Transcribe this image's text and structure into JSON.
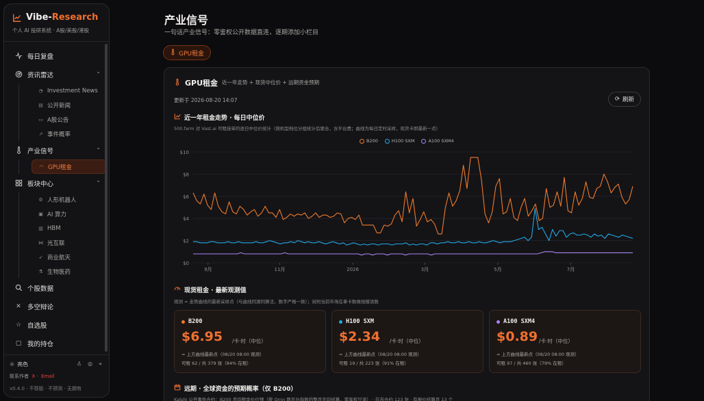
{
  "brand": {
    "name_a": "Vibe-",
    "name_b": "Research",
    "subtitle": "个人 AI 投研系统 · A股/美股/港股"
  },
  "sidebar": {
    "items": [
      {
        "label": "每日复盘",
        "icon": "pulse-icon"
      },
      {
        "label": "资讯雷达",
        "icon": "radar-icon",
        "children": [
          {
            "label": "Investment News"
          },
          {
            "label": "公开新闻"
          },
          {
            "label": "A股公告"
          },
          {
            "label": "事件概率"
          }
        ]
      },
      {
        "label": "产业信号",
        "icon": "thermometer-icon",
        "children": [
          {
            "label": "GPU租金"
          }
        ]
      },
      {
        "label": "板块中心",
        "icon": "grid-icon",
        "children": [
          {
            "label": "人形机器人"
          },
          {
            "label": "AI 算力"
          },
          {
            "label": "HBM"
          },
          {
            "label": "光互联"
          },
          {
            "label": "商业航天"
          },
          {
            "label": "生物医药"
          }
        ]
      },
      {
        "label": "个股数据",
        "icon": "search-icon"
      },
      {
        "label": "多空辩论",
        "icon": "swords-icon"
      },
      {
        "label": "自选股",
        "icon": "star-icon"
      },
      {
        "label": "我的持仓",
        "icon": "wallet-icon"
      }
    ],
    "footer": {
      "theme_label": "亮色",
      "contact_prefix": "联系作者",
      "contact_x": "X",
      "contact_email": "Email",
      "version": "v0.4.0 · 不荐股 · 不预测 · 无拥有"
    }
  },
  "page": {
    "title": "产业信号",
    "subtitle": "一句话产业信号：零鉴权公开数据直连，逐期添加小栏目",
    "tag": "GPU租金"
  },
  "card": {
    "title": "GPU租金",
    "desc": "近一年走势 + 现货中位价 + 远期资金预期",
    "updated": "更新于 2026-08-20 14:07",
    "refresh_label": "刷新",
    "trend_title": "近一年租金走势 · 每日中位价",
    "trend_note": "500.farm 对 Vast.ai 可租挂单的逐日中位价统计（按机型档位分组统计后聚合，含平台费；曲线为每日定时采样，现货卡即最新一点）",
    "spot_title": "现货租金 · 最新观测值",
    "spot_note": "观测 = 走势曲线的最新采样点（与曲线同源同算法，数字严格一致）；另附当前市场在拿卡数做规模读数",
    "forward_title": "远期 · 全球资金的预期概率（仅 B200）",
    "forward_note": "Kalshi 公开事件合约：B200 月均租金价位预（按 Ornn 两平台指数的整月平均结算，零鉴权只读） · 在市合约 123 张 · 有报价结算月 13 个"
  },
  "prices": [
    {
      "name": "B200",
      "price": "$6.95",
      "unit": "/卡·时（中位）",
      "line1": "= 上方曲线最新点（08/20 08:00 观测）",
      "line2": "可租 62 / 共 379 张（84% 在租）"
    },
    {
      "name": "H100 SXM",
      "price": "$2.34",
      "unit": "/卡·时（中位）",
      "line1": "= 上方曲线最新点（08/20 08:00 观测）",
      "line2": "可租 19 / 共 223 张（91% 在租）"
    },
    {
      "name": "A100 SXM4",
      "price": "$0.89",
      "unit": "/卡·时（中位）",
      "line1": "= 上方曲线最新点（08/20 08:00 观测）",
      "line2": "可租 97 / 共 460 张（79% 在租）"
    }
  ],
  "colors": {
    "b200": "#f07a2a",
    "h100": "#22a8e6",
    "a100": "#a885f0",
    "accent": "#f07030"
  },
  "chart_data": {
    "type": "line",
    "x_ticks": [
      "9月",
      "11月",
      "2026",
      "3月",
      "5月",
      "7月"
    ],
    "y_ticks": [
      "$0",
      "$2",
      "$4",
      "$6",
      "$8",
      "$10"
    ],
    "ylim": [
      0,
      10
    ],
    "x_index_range": [
      0,
      120
    ],
    "series": [
      {
        "name": "B200",
        "color": "#f07a2a",
        "values": [
          6.3,
          5.6,
          5.3,
          6.2,
          5.2,
          4.8,
          6.3,
          5.1,
          4.6,
          4.4,
          5.5,
          4.6,
          4.4,
          5.1,
          4.8,
          4.3,
          4.6,
          4.8,
          4.2,
          4.5,
          5.1,
          4.5,
          4.5,
          4.1,
          4.8,
          3.9,
          4.1,
          4.4,
          4.2,
          4.4,
          4.3,
          4.5,
          4.0,
          4.2,
          4.5,
          4.1,
          4.3,
          4.3,
          4.1,
          4.2,
          4.5,
          4.4,
          3.6,
          4.0,
          4.1,
          3.9,
          4.3,
          3.4,
          3.4,
          3.4,
          3.4,
          2.7,
          2.7,
          3.4,
          3.3,
          3.5,
          4.3,
          4.7,
          3.7,
          6.4,
          4.5,
          5.8,
          3.3,
          3.9,
          4.6,
          3.7,
          3.9,
          3.5,
          2.6,
          2.6,
          5.0,
          6.3,
          5.1,
          5.6,
          6.5,
          8.8,
          6.7,
          9.5,
          9.5,
          9.5,
          7.5,
          4.4,
          3.6,
          4.6,
          6.9,
          7.6,
          4.4,
          4.6,
          5.8,
          4.1,
          3.8,
          5.0,
          5.8,
          4.2,
          4.7,
          5.3,
          3.8,
          4.0,
          6.7,
          5.0,
          5.2,
          6.4,
          5.1,
          7.7,
          4.7,
          4.5,
          6.4,
          5.2,
          5.8,
          7.3,
          5.9,
          5.8,
          6.7,
          6.9,
          8.0,
          7.3,
          6.3,
          6.8,
          7.1,
          5.9,
          5.3,
          5.7,
          6.9
        ]
      },
      {
        "name": "H100 SXM",
        "color": "#22a8e6",
        "values": [
          1.9,
          1.9,
          1.8,
          1.8,
          1.8,
          1.9,
          1.9,
          1.8,
          1.8,
          1.8,
          1.9,
          1.8,
          1.8,
          1.9,
          1.8,
          1.8,
          1.8,
          1.8,
          1.9,
          1.8,
          1.8,
          1.9,
          2.0,
          1.9,
          1.8,
          1.7,
          1.8,
          1.8,
          1.9,
          1.8,
          2.0,
          1.9,
          1.8,
          1.9,
          1.8,
          1.8,
          1.9,
          1.8,
          1.7,
          1.8,
          1.9,
          1.8,
          1.7,
          1.8,
          1.6,
          1.7,
          1.8,
          1.7,
          1.6,
          1.7,
          1.6,
          1.7,
          1.7,
          1.6,
          1.7,
          1.7,
          1.7,
          1.6,
          1.7,
          1.7,
          1.7,
          1.8,
          1.6,
          1.7,
          1.6,
          1.7,
          1.7,
          1.6,
          1.8,
          1.8,
          1.7,
          1.8,
          1.8,
          1.9,
          1.8,
          1.8,
          1.9,
          1.8,
          1.8,
          1.9,
          1.8,
          1.8,
          1.9,
          1.8,
          1.8,
          1.9,
          2.0,
          1.9,
          1.8,
          1.9,
          1.9,
          1.9,
          2.0,
          2.1,
          2.2,
          2.3,
          2.0,
          2.3,
          4.9,
          3.0,
          3.2,
          2.6,
          2.0,
          3.0,
          2.4,
          2.9,
          2.9,
          2.3,
          2.6,
          2.7,
          2.5,
          2.5,
          2.6,
          2.5,
          2.3,
          2.6,
          2.4,
          2.5,
          2.2,
          2.6,
          2.5,
          2.4,
          2.3,
          2.5,
          2.4,
          2.3,
          2.2
        ]
      },
      {
        "name": "A100 SXM4",
        "color": "#a885f0",
        "values": [
          0.8,
          0.8,
          0.8,
          0.8,
          0.8,
          0.8,
          0.8,
          0.8,
          0.8,
          0.8,
          0.8,
          0.8,
          0.8,
          0.9,
          0.8,
          0.8,
          0.8,
          0.8,
          0.8,
          0.8,
          0.8,
          0.8,
          0.8,
          0.8,
          0.8,
          0.9,
          0.8,
          0.8,
          0.8,
          0.8,
          0.8,
          0.8,
          0.8,
          0.8,
          0.8,
          0.8,
          0.8,
          0.8,
          0.8,
          0.8,
          0.8,
          0.8,
          0.8,
          0.8,
          0.8,
          0.8,
          0.7,
          0.8,
          0.8,
          0.7,
          0.8,
          0.8,
          0.8,
          0.7,
          0.8,
          0.8,
          0.8,
          0.8,
          0.7,
          0.8,
          0.8,
          0.8,
          0.8,
          0.8,
          0.8,
          0.7,
          0.8,
          0.8,
          0.8,
          0.8,
          0.8,
          0.8,
          0.8,
          0.8,
          0.8,
          0.8,
          0.8,
          0.8,
          0.8,
          0.8,
          0.8,
          0.8,
          0.8,
          0.8,
          0.8,
          0.8,
          0.8,
          0.8,
          0.8,
          0.8,
          0.8,
          0.8,
          0.8,
          0.8,
          0.8,
          0.9,
          1.0,
          1.0,
          1.0,
          0.9,
          0.9,
          0.9,
          0.9,
          0.9,
          0.9,
          0.9,
          0.9,
          0.9,
          0.9,
          0.9,
          0.9,
          0.9,
          0.9,
          0.9,
          0.9,
          0.9,
          0.9,
          0.9,
          0.9,
          0.9,
          0.9
        ]
      }
    ],
    "legend_position": "top-center",
    "grid": true
  }
}
